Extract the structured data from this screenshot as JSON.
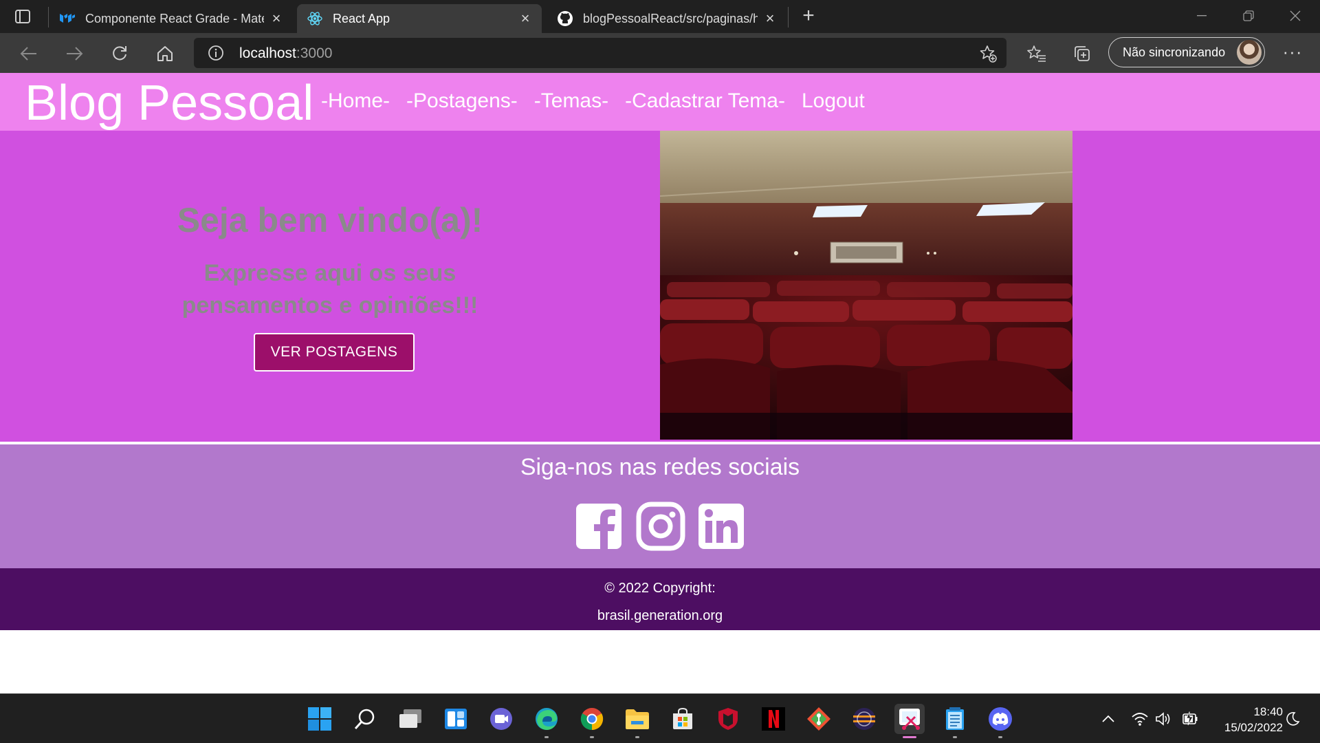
{
  "browser": {
    "tabs": [
      {
        "title": "Componente React Grade - Mate",
        "icon": "mui-logo-icon",
        "active": false
      },
      {
        "title": "React App",
        "icon": "react-logo-icon",
        "active": true
      },
      {
        "title": "blogPessoalReact/src/paginas/hc",
        "icon": "github-icon",
        "active": false
      }
    ],
    "address_host": "localhost",
    "address_port": ":3000",
    "profile_label": "Não sincronizando"
  },
  "page": {
    "brand": "Blog Pessoal",
    "nav": {
      "home": "-Home-",
      "posts": "-Postagens-",
      "themes": "-Temas-",
      "new_theme": "-Cadastrar Tema-",
      "logout": "Logout"
    },
    "hero": {
      "title": "Seja bem vindo(a)!",
      "subtitle": "Expresse aqui os seus pensamentos e opiniões!!!",
      "button": "VER POSTAGENS"
    },
    "social": {
      "title": "Siga-nos nas redes sociais",
      "icons": [
        "facebook-icon",
        "instagram-icon",
        "linkedin-icon"
      ]
    },
    "footer": {
      "copyright": "© 2022 Copyright:",
      "site": "brasil.generation.org"
    },
    "colors": {
      "navbar": "#ee82ee",
      "hero": "#d050e0",
      "button": "#9c0f6a",
      "social": "#b278cc",
      "footer": "#4d0e62"
    }
  },
  "taskbar": {
    "time": "18:40",
    "date": "15/02/2022"
  }
}
